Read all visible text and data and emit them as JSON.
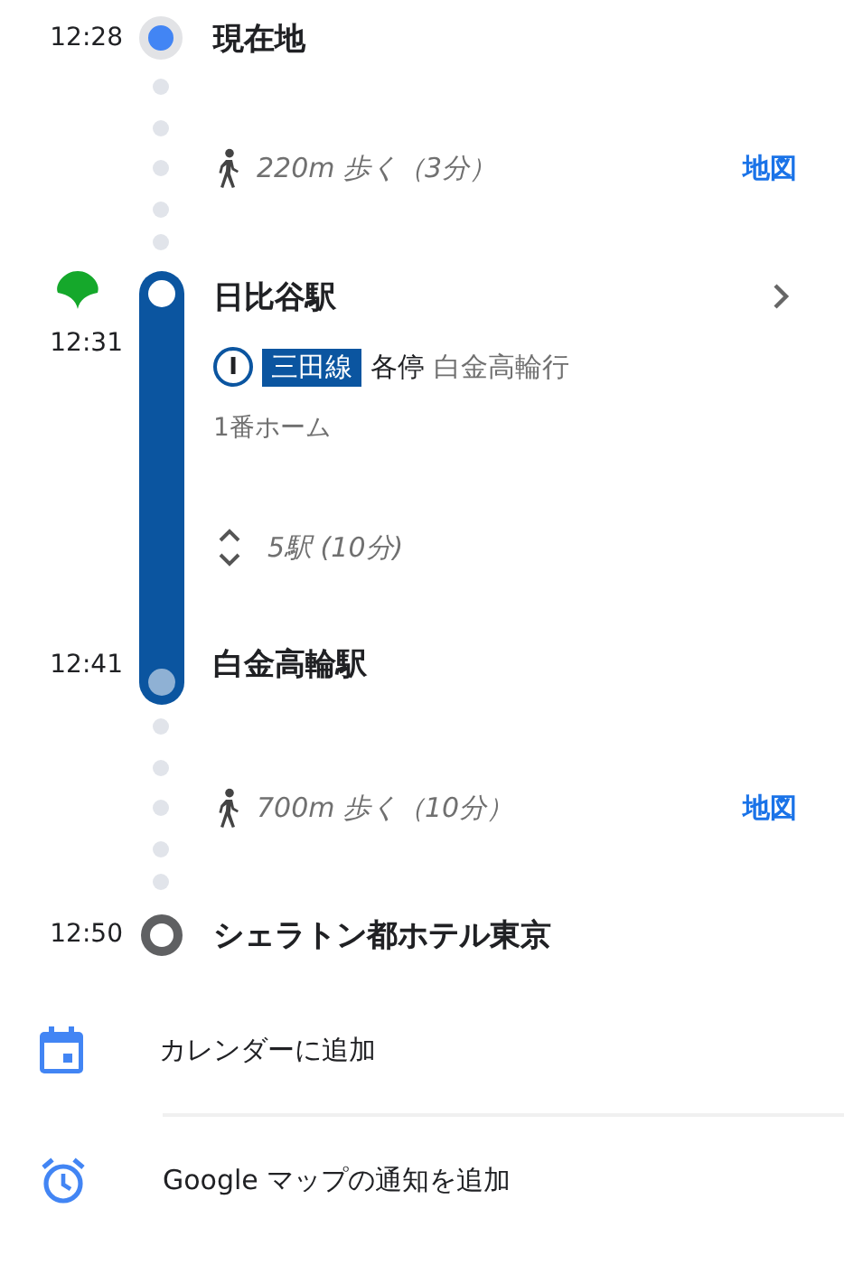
{
  "origin": {
    "time": "12:28",
    "name": "現在地"
  },
  "legs": [
    {
      "kind": "walk",
      "text": "220m 歩く（3分）",
      "map_link": "地図"
    },
    {
      "kind": "transit",
      "board_time": "12:31",
      "board_station": "日比谷駅",
      "line_letter": "I",
      "line_name": "三田線",
      "service": "各停",
      "direction": "白金高輪行",
      "platform": "1番ホーム",
      "stops": "5駅 (10分)",
      "alight_time": "12:41",
      "alight_station": "白金高輪駅"
    },
    {
      "kind": "walk",
      "text": "700m 歩く（10分）",
      "map_link": "地図"
    }
  ],
  "destination": {
    "time": "12:50",
    "name": "シェラトン都ホテル東京"
  },
  "actions": [
    {
      "kind": "calendar",
      "label": "カレンダーに追加"
    },
    {
      "kind": "alarm",
      "label": "Google マップの通知を追加"
    }
  ]
}
